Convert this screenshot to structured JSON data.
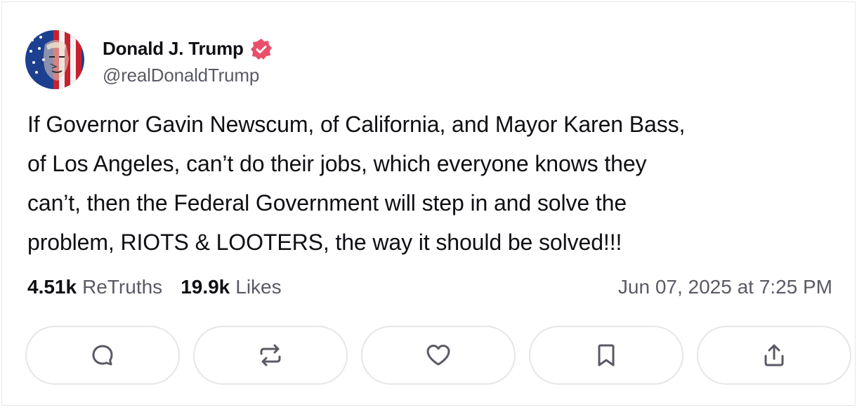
{
  "post": {
    "author": {
      "display_name": "Donald J. Trump",
      "handle": "@realDonaldTrump",
      "verified_icon": "verified-badge-icon",
      "verified_color": "#e8506a"
    },
    "text": "If Governor Gavin Newscum, of California, and Mayor Karen Bass,\nof Los Angeles, can’t do their jobs, which everyone knows they\ncan’t, then the Federal Government will step in and solve the\nproblem, RIOTS & LOOTERS, the way it should be solved!!!",
    "stats": {
      "retruths_count": "4.51k",
      "retruths_label": "ReTruths",
      "likes_count": "19.9k",
      "likes_label": "Likes"
    },
    "timestamp": "Jun 07, 2025 at 7:25 PM"
  },
  "actions": [
    {
      "name": "reply",
      "icon": "reply-icon"
    },
    {
      "name": "retruth",
      "icon": "retruth-icon"
    },
    {
      "name": "like",
      "icon": "heart-icon"
    },
    {
      "name": "bookmark",
      "icon": "bookmark-icon"
    },
    {
      "name": "share",
      "icon": "share-icon"
    }
  ],
  "colors": {
    "text": "#0f0f14",
    "muted": "#5a5a66",
    "border": "#e6e6ea",
    "icon": "#5a5a66"
  }
}
